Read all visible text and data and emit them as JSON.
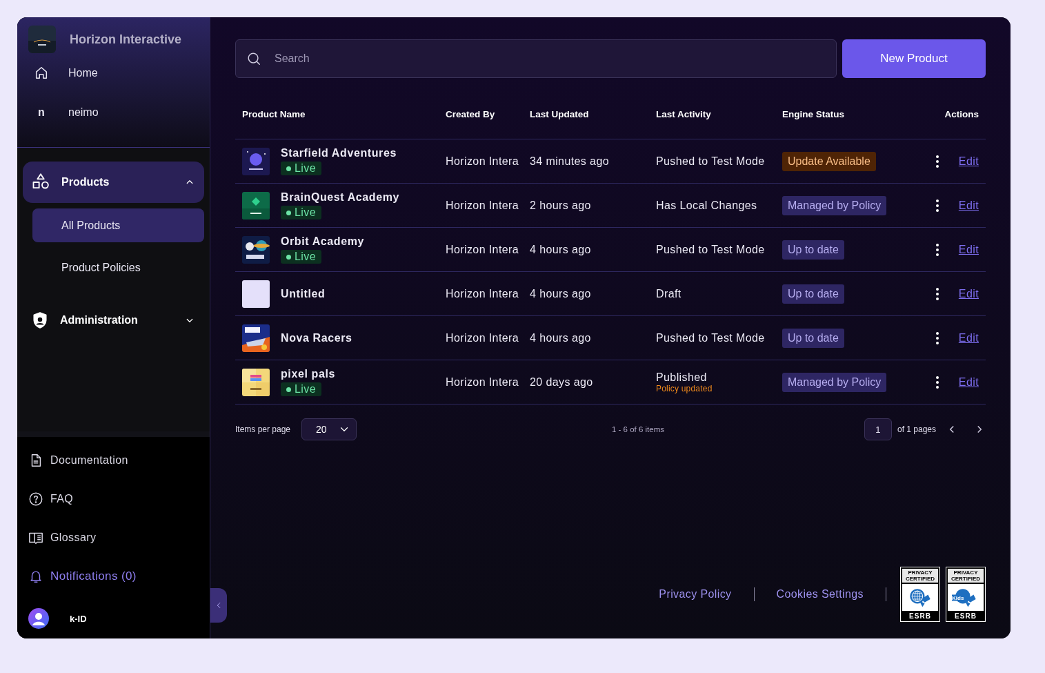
{
  "brand": {
    "name": "Horizon Interactive"
  },
  "nav": [
    {
      "kind": "icon",
      "label": "Home"
    },
    {
      "kind": "letter",
      "initial": "n",
      "label": "neimo"
    }
  ],
  "sections": [
    {
      "label": "Products",
      "expanded": true,
      "children": [
        {
          "label": "All Products",
          "selected": true
        },
        {
          "label": "Product Policies",
          "selected": false
        }
      ]
    },
    {
      "label": "Administration",
      "expanded": false
    }
  ],
  "help_links": [
    {
      "label": "Documentation",
      "accent": false
    },
    {
      "label": "FAQ",
      "accent": false
    },
    {
      "label": "Glossary",
      "accent": false
    },
    {
      "label": "Notifications (0)",
      "accent": true
    }
  ],
  "user": {
    "name": "k-ID"
  },
  "search": {
    "placeholder": "Search"
  },
  "new_button": "New Product",
  "table": {
    "columns": [
      "Product Name",
      "Created By",
      "Last Updated",
      "Last Activity",
      "Engine Status",
      "Actions"
    ],
    "rows": [
      {
        "name": "Starfield Adventures",
        "live": true,
        "live_label": "Live",
        "created_by": "Horizon Intera",
        "last_updated": "34 minutes ago",
        "last_activity": "Pushed to Test Mode",
        "engine_status": {
          "label": "Update Available",
          "kind": "warning"
        },
        "action": "Edit"
      },
      {
        "name": "BrainQuest Academy",
        "live": true,
        "live_label": "Live",
        "created_by": "Horizon Intera",
        "last_updated": "2 hours ago",
        "last_activity": "Has Local Changes",
        "engine_status": {
          "label": "Managed by Policy",
          "kind": "info"
        },
        "action": "Edit"
      },
      {
        "name": "Orbit Academy",
        "live": true,
        "live_label": "Live",
        "created_by": "Horizon Intera",
        "last_updated": "4 hours ago",
        "last_activity": "Pushed to Test Mode",
        "engine_status": {
          "label": "Up to date",
          "kind": "info"
        },
        "action": "Edit"
      },
      {
        "thumbnail": {
          "kind": "blank"
        },
        "name": "Untitled",
        "live": false,
        "created_by": "Horizon Intera",
        "last_updated": "4 hours ago",
        "last_activity": "Draft",
        "engine_status": {
          "label": "Up to date",
          "kind": "info"
        },
        "action": "Edit"
      },
      {
        "name": "Nova Racers",
        "live": false,
        "created_by": "Horizon Intera",
        "last_updated": "4 hours ago",
        "last_activity": "Pushed to Test Mode",
        "engine_status": {
          "label": "Up to date",
          "kind": "info"
        },
        "action": "Edit"
      },
      {
        "name": "pixel pals",
        "live": true,
        "live_label": "Live",
        "created_by": "Horizon Intera",
        "last_updated": "20 days ago",
        "last_activity": "Published",
        "activity_note": "Policy updated",
        "engine_status": {
          "label": "Managed by Policy",
          "kind": "info"
        },
        "action": "Edit"
      }
    ]
  },
  "pagination": {
    "items_label": "Items per page",
    "page_size": "20",
    "range": "1 - 6 of 6 items",
    "page": "1",
    "of_pages": "of 1 pages"
  },
  "footer": {
    "links": [
      "Privacy Policy",
      "Cookies Settings"
    ],
    "badges": [
      {
        "top": "PRIVACY CERTIFIED",
        "bottom": "ESRB"
      },
      {
        "top": "PRIVACY CERTIFIED",
        "emblem": "Kids",
        "bottom": "ESRB"
      }
    ]
  }
}
